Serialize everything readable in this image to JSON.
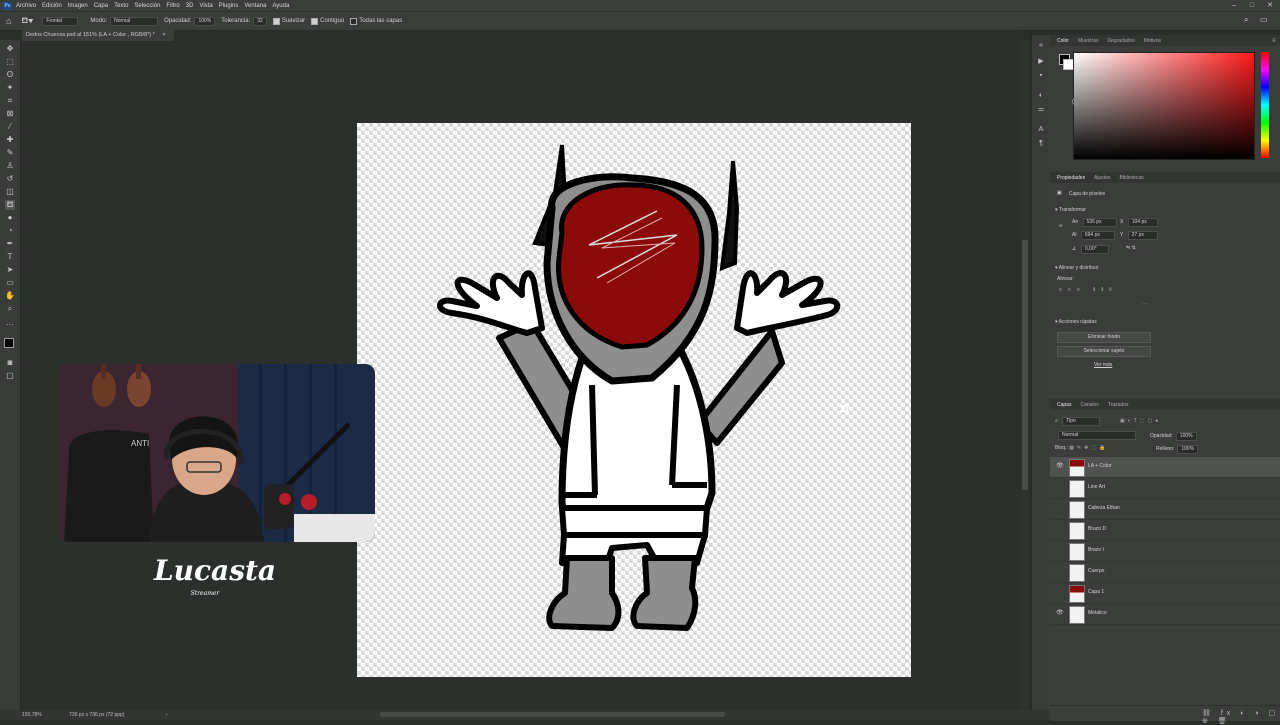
{
  "menubar": {
    "app_icon": "Ps",
    "items": [
      "Archivo",
      "Edición",
      "Imagen",
      "Capa",
      "Texto",
      "Selección",
      "Filtro",
      "3D",
      "Vista",
      "Plugins",
      "Ventana",
      "Ayuda"
    ]
  },
  "optbar": {
    "sample_label": "Frontal",
    "mode_label": "Modo:",
    "mode_value": "Normal",
    "opacity_label": "Opacidad:",
    "opacity_value": "100%",
    "tolerance_label": "Tolerancia:",
    "tolerance_value": "32",
    "smooth_label": "Suavizar",
    "contiguous_label": "Contiguo",
    "all_layers_label": "Todas las capas"
  },
  "document": {
    "tab_title": "Dedos Chuecos.psd al 151% (LA + Color , RGB/8*) *"
  },
  "status": {
    "zoom": "150,78%",
    "dimensions": "736 px x 736 px (72 ppp)"
  },
  "overlay": {
    "streamer_name": "Lucasta",
    "streamer_subtitle": "Streamer",
    "cap_text": "ANTI"
  },
  "color_panel": {
    "tabs": [
      "Color",
      "Muestras",
      "Degradados",
      "Motivos"
    ],
    "active_tab": "Color",
    "hue_color": "#ff1a1a"
  },
  "properties_panel": {
    "tabs": [
      "Propiedades",
      "Ajustes",
      "Bibliotecas"
    ],
    "active_tab": "Propiedades",
    "layer_type": "Capa de píxeles",
    "transform_label": "Transformar",
    "w_label": "An",
    "w_value": "536 px",
    "h_label": "Al",
    "h_value": "694 px",
    "x_label": "X",
    "x_value": "104 px",
    "y_label": "Y",
    "y_value": "27 px",
    "angle_value": "0,00°",
    "align_label": "Alinear y distribuir",
    "align_sub": "Alinear:",
    "quick_actions_label": "Acciones rápidas",
    "btn_remove_bg": "Eliminar fondo",
    "btn_select_subject": "Seleccionar sujeto",
    "more_link": "Ver más"
  },
  "layers_panel": {
    "tabs": [
      "Capas",
      "Canales",
      "Trazados"
    ],
    "active_tab": "Capas",
    "filter_label": "Tipo",
    "blend_mode": "Normal",
    "opacity_label": "Opacidad:",
    "opacity_value": "100%",
    "lock_label": "Bloq.:",
    "fill_label": "Relleno:",
    "fill_value": "100%",
    "layers": [
      {
        "name": "LA + Color",
        "visible": true,
        "selected": true
      },
      {
        "name": "Line Art",
        "visible": false,
        "selected": false
      },
      {
        "name": "Cabeza Ethan",
        "visible": false,
        "selected": false
      },
      {
        "name": "Brazo D",
        "visible": false,
        "selected": false
      },
      {
        "name": "Brazo I",
        "visible": false,
        "selected": false
      },
      {
        "name": "Cuerpo",
        "visible": false,
        "selected": false
      },
      {
        "name": "Capa 1",
        "visible": false,
        "selected": false
      },
      {
        "name": "Metalico",
        "visible": true,
        "selected": false
      }
    ]
  },
  "icons": {
    "eye": "eye-icon",
    "home": "home-icon",
    "search": "search-icon",
    "bucket": "paint-bucket-icon"
  }
}
